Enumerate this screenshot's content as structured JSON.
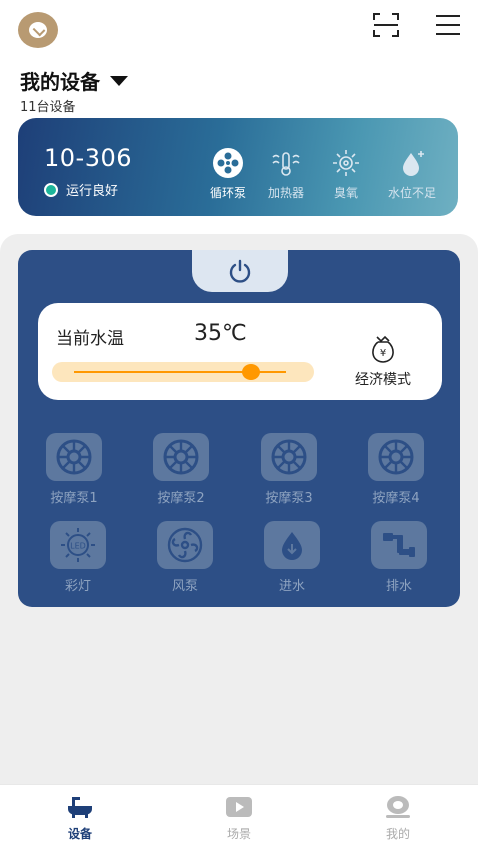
{
  "header": {
    "logo_text": "",
    "scan_icon": "scan-icon",
    "menu_icon": "menu-icon"
  },
  "devices": {
    "title": "我的设备",
    "count_label": "11台设备"
  },
  "device_card": {
    "id": "10-306",
    "status": "运行良好",
    "status_color": "#1db59a",
    "features": [
      {
        "label": "循环泵",
        "icon": "fan-icon",
        "active": true
      },
      {
        "label": "加热器",
        "icon": "heater-icon",
        "active": false
      },
      {
        "label": "臭氧",
        "icon": "ozone-icon",
        "active": false
      },
      {
        "label": "水位不足",
        "icon": "water-level-icon",
        "active": false
      }
    ]
  },
  "control": {
    "power_icon": "power-icon",
    "temp_label": "当前水温",
    "temp_value": "35℃",
    "temp_slider_fraction": 0.84,
    "eco_label": "经济模式",
    "eco_icon": "money-bag-icon",
    "buttons_row1": [
      {
        "label": "按摩泵1",
        "icon": "massage-pump-icon"
      },
      {
        "label": "按摩泵2",
        "icon": "massage-pump-icon"
      },
      {
        "label": "按摩泵3",
        "icon": "massage-pump-icon"
      },
      {
        "label": "按摩泵4",
        "icon": "massage-pump-icon"
      }
    ],
    "buttons_row2": [
      {
        "label": "彩灯",
        "icon": "led-light-icon"
      },
      {
        "label": "风泵",
        "icon": "air-pump-icon"
      },
      {
        "label": "进水",
        "icon": "water-inlet-icon"
      },
      {
        "label": "排水",
        "icon": "drain-icon"
      }
    ]
  },
  "bottom_nav": [
    {
      "label": "设备",
      "icon": "bathtub-icon",
      "active": true
    },
    {
      "label": "场景",
      "icon": "play-icon",
      "active": false
    },
    {
      "label": "我的",
      "icon": "profile-icon",
      "active": false
    }
  ],
  "colors": {
    "accent": "#2d4f86",
    "slider": "#ff9800",
    "active_nav": "#1e3f78"
  }
}
